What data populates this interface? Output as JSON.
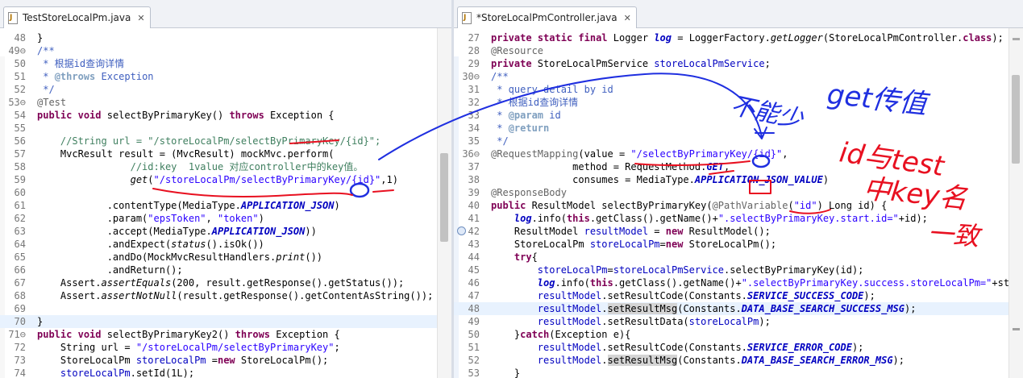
{
  "left_editor": {
    "tab": {
      "title": "TestStoreLocalPm.java",
      "close_glyph": "✕"
    },
    "lines": [
      {
        "n": "48",
        "t": [
          [
            "}",
            ""
          ]
        ]
      },
      {
        "n": "49⊖",
        "t": [
          [
            "/**",
            "jd"
          ]
        ]
      },
      {
        "n": "50",
        "t": [
          [
            " * 根据id查询详情",
            "jd"
          ]
        ]
      },
      {
        "n": "51",
        "t": [
          [
            " * ",
            "jd"
          ],
          [
            "@throws",
            "jt"
          ],
          [
            " Exception",
            "jd"
          ]
        ]
      },
      {
        "n": "52",
        "t": [
          [
            " */",
            "jd"
          ]
        ]
      },
      {
        "n": "53⊖",
        "t": [
          [
            "@Test",
            "an"
          ]
        ]
      },
      {
        "n": "54",
        "t": [
          [
            "public",
            "kw"
          ],
          [
            " ",
            ""
          ],
          [
            "void",
            "kw"
          ],
          [
            " selectByPrimaryKey() ",
            ""
          ],
          [
            "throws",
            "kw"
          ],
          [
            " Exception {",
            ""
          ]
        ]
      },
      {
        "n": "55",
        "t": [
          [
            "",
            ""
          ]
        ]
      },
      {
        "n": "56",
        "t": [
          [
            "    //String url = \"/storeLocalPm/selectByPrimaryKey/{id}\";",
            "cm"
          ]
        ]
      },
      {
        "n": "57",
        "t": [
          [
            "    MvcResult result = (MvcResult) mockMvc.perform(",
            ""
          ]
        ]
      },
      {
        "n": "58",
        "t": [
          [
            "                //id:key  1value 对应controller中的key值。",
            "cm"
          ]
        ]
      },
      {
        "n": "59",
        "t": [
          [
            "                ",
            ""
          ],
          [
            "get",
            "it"
          ],
          [
            "(",
            ""
          ],
          [
            "\"/storeLocalPm/selectByPrimaryKey/{id}\"",
            "st"
          ],
          [
            ",1)",
            ""
          ]
        ]
      },
      {
        "n": "60",
        "t": [
          [
            "",
            ""
          ]
        ]
      },
      {
        "n": "61",
        "t": [
          [
            "            .contentType(MediaType.",
            ""
          ],
          [
            "APPLICATION_JSON",
            "sf"
          ],
          [
            ")",
            ""
          ]
        ]
      },
      {
        "n": "62",
        "t": [
          [
            "            .param(",
            ""
          ],
          [
            "\"epsToken\"",
            "st"
          ],
          [
            ", ",
            ""
          ],
          [
            "\"token\"",
            "st"
          ],
          [
            ")",
            ""
          ]
        ]
      },
      {
        "n": "63",
        "t": [
          [
            "            .accept(MediaType.",
            ""
          ],
          [
            "APPLICATION_JSON",
            "sf"
          ],
          [
            "))",
            ""
          ]
        ]
      },
      {
        "n": "64",
        "t": [
          [
            "            .andExpect(",
            ""
          ],
          [
            "status",
            "it"
          ],
          [
            "().isOk())",
            ""
          ]
        ]
      },
      {
        "n": "65",
        "t": [
          [
            "            .andDo(MockMvcResultHandlers.",
            ""
          ],
          [
            "print",
            "it"
          ],
          [
            "())",
            ""
          ]
        ]
      },
      {
        "n": "66",
        "t": [
          [
            "            .andReturn();",
            ""
          ]
        ]
      },
      {
        "n": "67",
        "t": [
          [
            "    Assert.",
            ""
          ],
          [
            "assertEquals",
            "it"
          ],
          [
            "(200, result.getResponse().getStatus());",
            ""
          ]
        ]
      },
      {
        "n": "68",
        "t": [
          [
            "    Assert.",
            ""
          ],
          [
            "assertNotNull",
            "it"
          ],
          [
            "(result.getResponse().getContentAsString());",
            ""
          ]
        ]
      },
      {
        "n": "69",
        "t": [
          [
            "",
            ""
          ]
        ]
      },
      {
        "n": "70",
        "t": [
          [
            "}",
            ""
          ]
        ],
        "hl": true
      },
      {
        "n": "71⊖",
        "t": [
          [
            "public",
            "kw"
          ],
          [
            " ",
            ""
          ],
          [
            "void",
            "kw"
          ],
          [
            " selectByPrimaryKey2() ",
            ""
          ],
          [
            "throws",
            "kw"
          ],
          [
            " Exception {",
            ""
          ]
        ]
      },
      {
        "n": "72",
        "t": [
          [
            "    String url = ",
            ""
          ],
          [
            "\"/storeLocalPm/selectByPrimaryKey\"",
            "st"
          ],
          [
            ";",
            ""
          ]
        ]
      },
      {
        "n": "73",
        "t": [
          [
            "    StoreLocalPm ",
            ""
          ],
          [
            "storeLocalPm",
            "fl"
          ],
          [
            " =",
            ""
          ],
          [
            "new",
            "kw"
          ],
          [
            " StoreLocalPm();",
            ""
          ]
        ]
      },
      {
        "n": "74",
        "t": [
          [
            "    ",
            ""
          ],
          [
            "storeLocalPm",
            "fl"
          ],
          [
            ".setId(1L);",
            ""
          ]
        ]
      }
    ]
  },
  "right_editor": {
    "tab": {
      "title": "*StoreLocalPmController.java",
      "close_glyph": "✕"
    },
    "lines": [
      {
        "n": "27",
        "t": [
          [
            "private",
            "kw"
          ],
          [
            " ",
            ""
          ],
          [
            "static",
            "kw"
          ],
          [
            " ",
            ""
          ],
          [
            "final",
            "kw"
          ],
          [
            " Logger ",
            ""
          ],
          [
            "log",
            "sf"
          ],
          [
            " = LoggerFactory.",
            ""
          ],
          [
            "getLogger",
            "it"
          ],
          [
            "(StoreLocalPmController.",
            ""
          ],
          [
            "class",
            "kw"
          ],
          [
            ");",
            ""
          ]
        ]
      },
      {
        "n": "28",
        "t": [
          [
            "@Resource",
            "an"
          ]
        ]
      },
      {
        "n": "29",
        "t": [
          [
            "private",
            "kw"
          ],
          [
            " StoreLocalPmService ",
            ""
          ],
          [
            "storeLocalPmService",
            "fl"
          ],
          [
            ";",
            ""
          ]
        ]
      },
      {
        "n": "30⊖",
        "t": [
          [
            "/**",
            "jd"
          ]
        ]
      },
      {
        "n": "31",
        "t": [
          [
            " * query detail by id",
            "jd"
          ]
        ]
      },
      {
        "n": "32",
        "t": [
          [
            " * 根据id查询详情",
            "jd"
          ]
        ]
      },
      {
        "n": "33",
        "t": [
          [
            " * ",
            "jd"
          ],
          [
            "@param",
            "jt"
          ],
          [
            " id",
            "jd"
          ]
        ]
      },
      {
        "n": "34",
        "t": [
          [
            " * ",
            "jd"
          ],
          [
            "@return",
            "jt"
          ]
        ]
      },
      {
        "n": "35",
        "t": [
          [
            " */",
            "jd"
          ]
        ]
      },
      {
        "n": "36⊖",
        "t": [
          [
            "@RequestMapping",
            "an"
          ],
          [
            "(value = ",
            ""
          ],
          [
            "\"/selectByPrimaryKey/{id}\"",
            "st"
          ],
          [
            ",",
            ""
          ]
        ]
      },
      {
        "n": "37",
        "t": [
          [
            "              method = RequestMethod.",
            ""
          ],
          [
            "GET",
            "sf"
          ],
          [
            ",",
            ""
          ]
        ]
      },
      {
        "n": "38",
        "t": [
          [
            "              consumes = MediaType.",
            ""
          ],
          [
            "APPLICATION_JSON_VALUE",
            "sf"
          ],
          [
            ")",
            ""
          ]
        ]
      },
      {
        "n": "39",
        "t": [
          [
            "@ResponseBody",
            "an"
          ]
        ]
      },
      {
        "n": "40",
        "t": [
          [
            "public",
            "kw"
          ],
          [
            " ResultModel selectByPrimaryKey(",
            ""
          ],
          [
            "@PathVariable",
            "an"
          ],
          [
            "(",
            ""
          ],
          [
            "\"id\"",
            "st"
          ],
          [
            ") Long id) {",
            ""
          ]
        ]
      },
      {
        "n": "41",
        "t": [
          [
            "    ",
            ""
          ],
          [
            "log",
            "sf"
          ],
          [
            ".info(",
            ""
          ],
          [
            "this",
            "kw"
          ],
          [
            ".getClass().getName()+",
            ""
          ],
          [
            "\".selectByPrimaryKey.start.id=\"",
            "st"
          ],
          [
            "+id);",
            ""
          ]
        ]
      },
      {
        "n": "42",
        "t": [
          [
            "    ResultModel ",
            ""
          ],
          [
            "resultModel",
            "fl"
          ],
          [
            " = ",
            ""
          ],
          [
            "new",
            "kw"
          ],
          [
            " ResultModel();",
            ""
          ]
        ]
      },
      {
        "n": "43",
        "t": [
          [
            "    StoreLocalPm ",
            ""
          ],
          [
            "storeLocalPm",
            "fl"
          ],
          [
            "=",
            ""
          ],
          [
            "new",
            "kw"
          ],
          [
            " StoreLocalPm();",
            ""
          ]
        ]
      },
      {
        "n": "44",
        "t": [
          [
            "    ",
            ""
          ],
          [
            "try",
            "kw"
          ],
          [
            "{",
            ""
          ]
        ]
      },
      {
        "n": "45",
        "t": [
          [
            "        ",
            ""
          ],
          [
            "storeLocalPm",
            "fl"
          ],
          [
            "=",
            ""
          ],
          [
            "storeLocalPmService",
            "fl"
          ],
          [
            ".selectByPrimaryKey(id);",
            ""
          ]
        ]
      },
      {
        "n": "46",
        "t": [
          [
            "        ",
            ""
          ],
          [
            "log",
            "sf"
          ],
          [
            ".info(",
            ""
          ],
          [
            "this",
            "kw"
          ],
          [
            ".getClass().getName()+",
            ""
          ],
          [
            "\".selectByPrimaryKey.success.storeLocalPm=\"",
            "st"
          ],
          [
            "+sto",
            ""
          ]
        ]
      },
      {
        "n": "47",
        "t": [
          [
            "        ",
            ""
          ],
          [
            "resultModel",
            "fl"
          ],
          [
            ".setResultCode(Constants.",
            ""
          ],
          [
            "SERVICE_SUCCESS_CODE",
            "sf"
          ],
          [
            ");",
            ""
          ]
        ]
      },
      {
        "n": "48",
        "t": [
          [
            "        ",
            ""
          ],
          [
            "resultModel",
            "fl"
          ],
          [
            ".",
            ""
          ],
          [
            "setResultMsg",
            "occ"
          ],
          [
            "(Constants.",
            ""
          ],
          [
            "DATA_BASE_SEARCH_SUCCESS_MSG",
            "sf"
          ],
          [
            ");",
            ""
          ]
        ],
        "hl": true
      },
      {
        "n": "49",
        "t": [
          [
            "        ",
            ""
          ],
          [
            "resultModel",
            "fl"
          ],
          [
            ".setResultData(",
            ""
          ],
          [
            "storeLocalPm",
            "fl"
          ],
          [
            ");",
            ""
          ]
        ]
      },
      {
        "n": "50",
        "t": [
          [
            "    }",
            ""
          ],
          [
            "catch",
            "kw"
          ],
          [
            "(Exception e){",
            ""
          ]
        ]
      },
      {
        "n": "51",
        "t": [
          [
            "        ",
            ""
          ],
          [
            "resultModel",
            "fl"
          ],
          [
            ".setResultCode(Constants.",
            ""
          ],
          [
            "SERVICE_ERROR_CODE",
            "sf"
          ],
          [
            ");",
            ""
          ]
        ]
      },
      {
        "n": "52",
        "t": [
          [
            "        ",
            ""
          ],
          [
            "resultModel",
            "fl"
          ],
          [
            ".",
            ""
          ],
          [
            "setResultMsg",
            "occ"
          ],
          [
            "(Constants.",
            ""
          ],
          [
            "DATA_BASE_SEARCH_ERROR_MSG",
            "sf"
          ],
          [
            ");",
            ""
          ]
        ]
      },
      {
        "n": "53",
        "t": [
          [
            "    }",
            ""
          ]
        ]
      }
    ]
  },
  "ink_annotations": {
    "notes": [
      "get传值",
      "不能少",
      "id与test",
      "中key名",
      "一致"
    ],
    "colors": {
      "blue": "#1f2fe0",
      "red": "#e81020"
    }
  },
  "colors": {
    "keyword": "#7f0055",
    "comment": "#3f7f5f",
    "javadoc": "#3f5fbf",
    "string": "#2a00ff",
    "annotation": "#646464",
    "field": "#0000c0",
    "current_line": "#e8f2fe"
  }
}
